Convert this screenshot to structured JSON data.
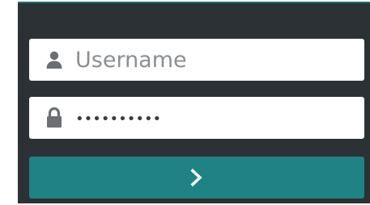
{
  "login_form": {
    "username": {
      "placeholder": "Username",
      "icon": "user-icon"
    },
    "password": {
      "value_masked": "••••••••••",
      "icon": "lock-icon"
    },
    "submit": {
      "icon": "chevron-right-icon"
    }
  },
  "colors": {
    "panel_bg": "#2b3134",
    "accent": "#1f8284",
    "field_bg": "#ffffff",
    "icon": "#6a6f73"
  }
}
